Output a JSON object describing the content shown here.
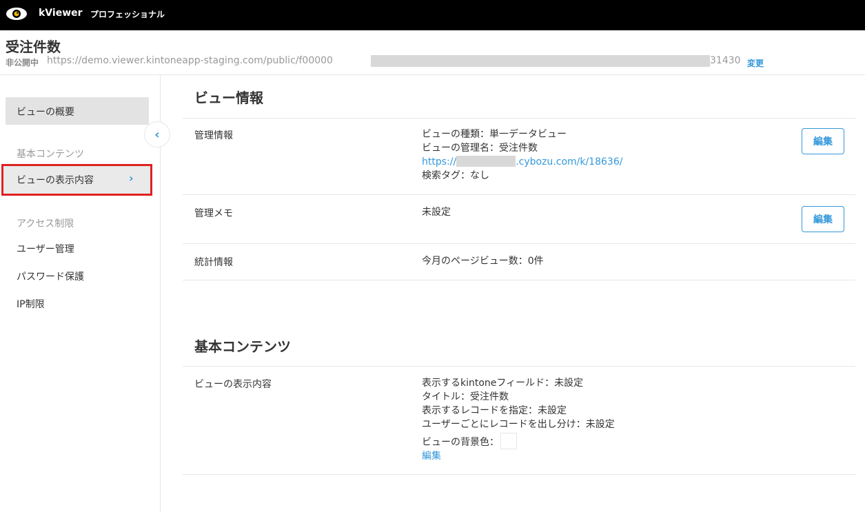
{
  "topbar": {
    "app_name": "kViewer",
    "edition": "プロフェッショナル"
  },
  "header": {
    "title": "受注件数",
    "status": "非公開中",
    "url_prefix": "https://demo.viewer.kintoneapp-staging.com/public/f00000",
    "url_suffix": "31430",
    "change_label": "変更"
  },
  "sidebar": {
    "overview": "ビューの概要",
    "section_basic": "基本コンテンツ",
    "display_content": "ビューの表示内容",
    "section_access": "アクセス制限",
    "user_management": "ユーザー管理",
    "password_protection": "パスワード保護",
    "ip_restriction": "IP制限"
  },
  "view_info": {
    "title": "ビュー情報",
    "management": {
      "label": "管理情報",
      "type": "ビューの種類：単一データビュー",
      "name": "ビューの管理名：受注件数",
      "url_prefix": "https://",
      "url_suffix": ".cybozu.com/k/18636/",
      "search_tag": "検索タグ：なし",
      "edit_label": "編集"
    },
    "memo": {
      "label": "管理メモ",
      "value": "未設定",
      "edit_label": "編集"
    },
    "stats": {
      "label": "統計情報",
      "value": "今月のページビュー数：0件"
    }
  },
  "basic_content": {
    "title": "基本コンテンツ",
    "display": {
      "label": "ビューの表示内容",
      "fields": "表示するkintoneフィールド：未設定",
      "title_line": "タイトル：受注件数",
      "records": "表示するレコードを指定：未設定",
      "per_user": "ユーザーごとにレコードを出し分け：未設定",
      "bg_color": "ビューの背景色：",
      "edit_label": "編集"
    }
  },
  "colors": {
    "accent": "#3498db",
    "topbar": "#000000",
    "highlight": "#e02020"
  }
}
